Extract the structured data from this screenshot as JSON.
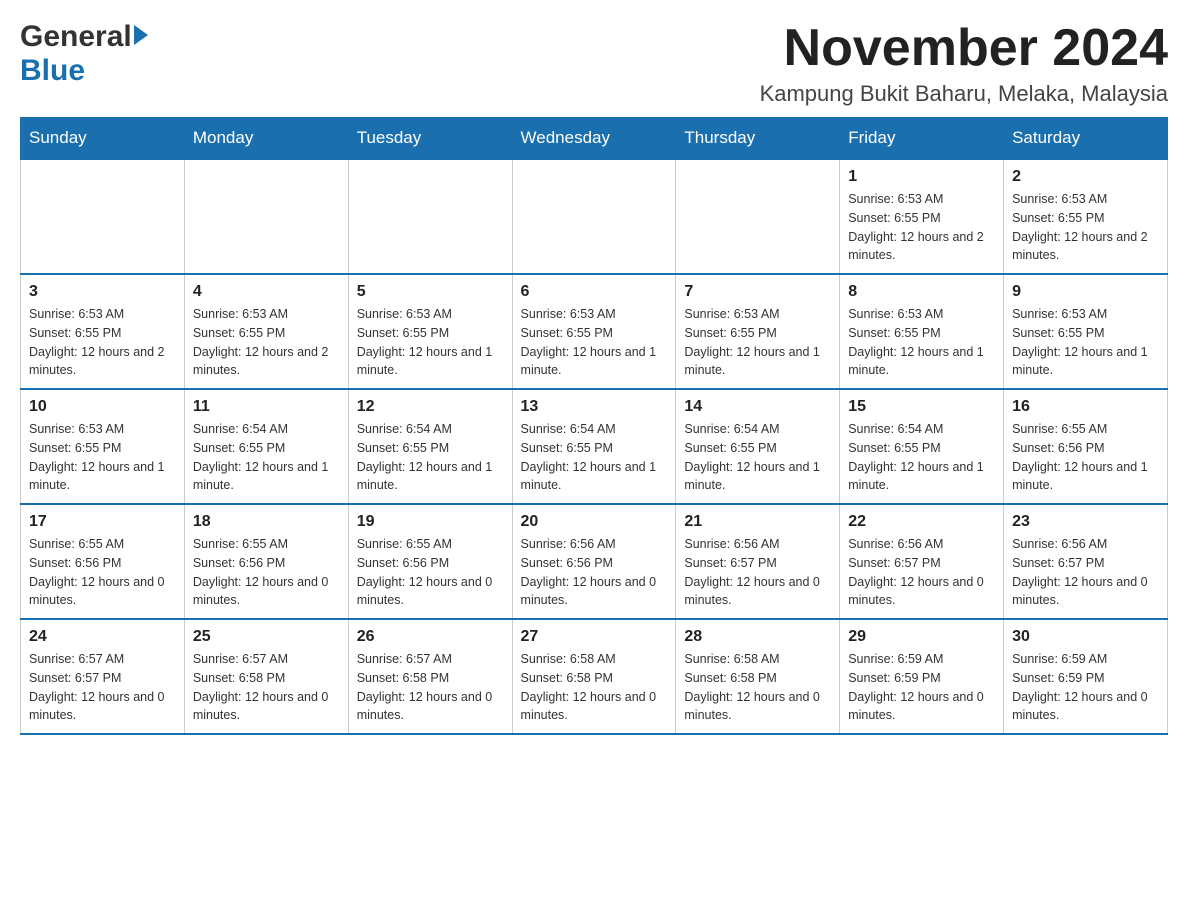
{
  "header": {
    "logo_general": "General",
    "logo_blue": "Blue",
    "month_title": "November 2024",
    "location": "Kampung Bukit Baharu, Melaka, Malaysia"
  },
  "days_of_week": [
    "Sunday",
    "Monday",
    "Tuesday",
    "Wednesday",
    "Thursday",
    "Friday",
    "Saturday"
  ],
  "weeks": [
    [
      {
        "day": "",
        "info": ""
      },
      {
        "day": "",
        "info": ""
      },
      {
        "day": "",
        "info": ""
      },
      {
        "day": "",
        "info": ""
      },
      {
        "day": "",
        "info": ""
      },
      {
        "day": "1",
        "info": "Sunrise: 6:53 AM\nSunset: 6:55 PM\nDaylight: 12 hours and 2 minutes."
      },
      {
        "day": "2",
        "info": "Sunrise: 6:53 AM\nSunset: 6:55 PM\nDaylight: 12 hours and 2 minutes."
      }
    ],
    [
      {
        "day": "3",
        "info": "Sunrise: 6:53 AM\nSunset: 6:55 PM\nDaylight: 12 hours and 2 minutes."
      },
      {
        "day": "4",
        "info": "Sunrise: 6:53 AM\nSunset: 6:55 PM\nDaylight: 12 hours and 2 minutes."
      },
      {
        "day": "5",
        "info": "Sunrise: 6:53 AM\nSunset: 6:55 PM\nDaylight: 12 hours and 1 minute."
      },
      {
        "day": "6",
        "info": "Sunrise: 6:53 AM\nSunset: 6:55 PM\nDaylight: 12 hours and 1 minute."
      },
      {
        "day": "7",
        "info": "Sunrise: 6:53 AM\nSunset: 6:55 PM\nDaylight: 12 hours and 1 minute."
      },
      {
        "day": "8",
        "info": "Sunrise: 6:53 AM\nSunset: 6:55 PM\nDaylight: 12 hours and 1 minute."
      },
      {
        "day": "9",
        "info": "Sunrise: 6:53 AM\nSunset: 6:55 PM\nDaylight: 12 hours and 1 minute."
      }
    ],
    [
      {
        "day": "10",
        "info": "Sunrise: 6:53 AM\nSunset: 6:55 PM\nDaylight: 12 hours and 1 minute."
      },
      {
        "day": "11",
        "info": "Sunrise: 6:54 AM\nSunset: 6:55 PM\nDaylight: 12 hours and 1 minute."
      },
      {
        "day": "12",
        "info": "Sunrise: 6:54 AM\nSunset: 6:55 PM\nDaylight: 12 hours and 1 minute."
      },
      {
        "day": "13",
        "info": "Sunrise: 6:54 AM\nSunset: 6:55 PM\nDaylight: 12 hours and 1 minute."
      },
      {
        "day": "14",
        "info": "Sunrise: 6:54 AM\nSunset: 6:55 PM\nDaylight: 12 hours and 1 minute."
      },
      {
        "day": "15",
        "info": "Sunrise: 6:54 AM\nSunset: 6:55 PM\nDaylight: 12 hours and 1 minute."
      },
      {
        "day": "16",
        "info": "Sunrise: 6:55 AM\nSunset: 6:56 PM\nDaylight: 12 hours and 1 minute."
      }
    ],
    [
      {
        "day": "17",
        "info": "Sunrise: 6:55 AM\nSunset: 6:56 PM\nDaylight: 12 hours and 0 minutes."
      },
      {
        "day": "18",
        "info": "Sunrise: 6:55 AM\nSunset: 6:56 PM\nDaylight: 12 hours and 0 minutes."
      },
      {
        "day": "19",
        "info": "Sunrise: 6:55 AM\nSunset: 6:56 PM\nDaylight: 12 hours and 0 minutes."
      },
      {
        "day": "20",
        "info": "Sunrise: 6:56 AM\nSunset: 6:56 PM\nDaylight: 12 hours and 0 minutes."
      },
      {
        "day": "21",
        "info": "Sunrise: 6:56 AM\nSunset: 6:57 PM\nDaylight: 12 hours and 0 minutes."
      },
      {
        "day": "22",
        "info": "Sunrise: 6:56 AM\nSunset: 6:57 PM\nDaylight: 12 hours and 0 minutes."
      },
      {
        "day": "23",
        "info": "Sunrise: 6:56 AM\nSunset: 6:57 PM\nDaylight: 12 hours and 0 minutes."
      }
    ],
    [
      {
        "day": "24",
        "info": "Sunrise: 6:57 AM\nSunset: 6:57 PM\nDaylight: 12 hours and 0 minutes."
      },
      {
        "day": "25",
        "info": "Sunrise: 6:57 AM\nSunset: 6:58 PM\nDaylight: 12 hours and 0 minutes."
      },
      {
        "day": "26",
        "info": "Sunrise: 6:57 AM\nSunset: 6:58 PM\nDaylight: 12 hours and 0 minutes."
      },
      {
        "day": "27",
        "info": "Sunrise: 6:58 AM\nSunset: 6:58 PM\nDaylight: 12 hours and 0 minutes."
      },
      {
        "day": "28",
        "info": "Sunrise: 6:58 AM\nSunset: 6:58 PM\nDaylight: 12 hours and 0 minutes."
      },
      {
        "day": "29",
        "info": "Sunrise: 6:59 AM\nSunset: 6:59 PM\nDaylight: 12 hours and 0 minutes."
      },
      {
        "day": "30",
        "info": "Sunrise: 6:59 AM\nSunset: 6:59 PM\nDaylight: 12 hours and 0 minutes."
      }
    ]
  ]
}
